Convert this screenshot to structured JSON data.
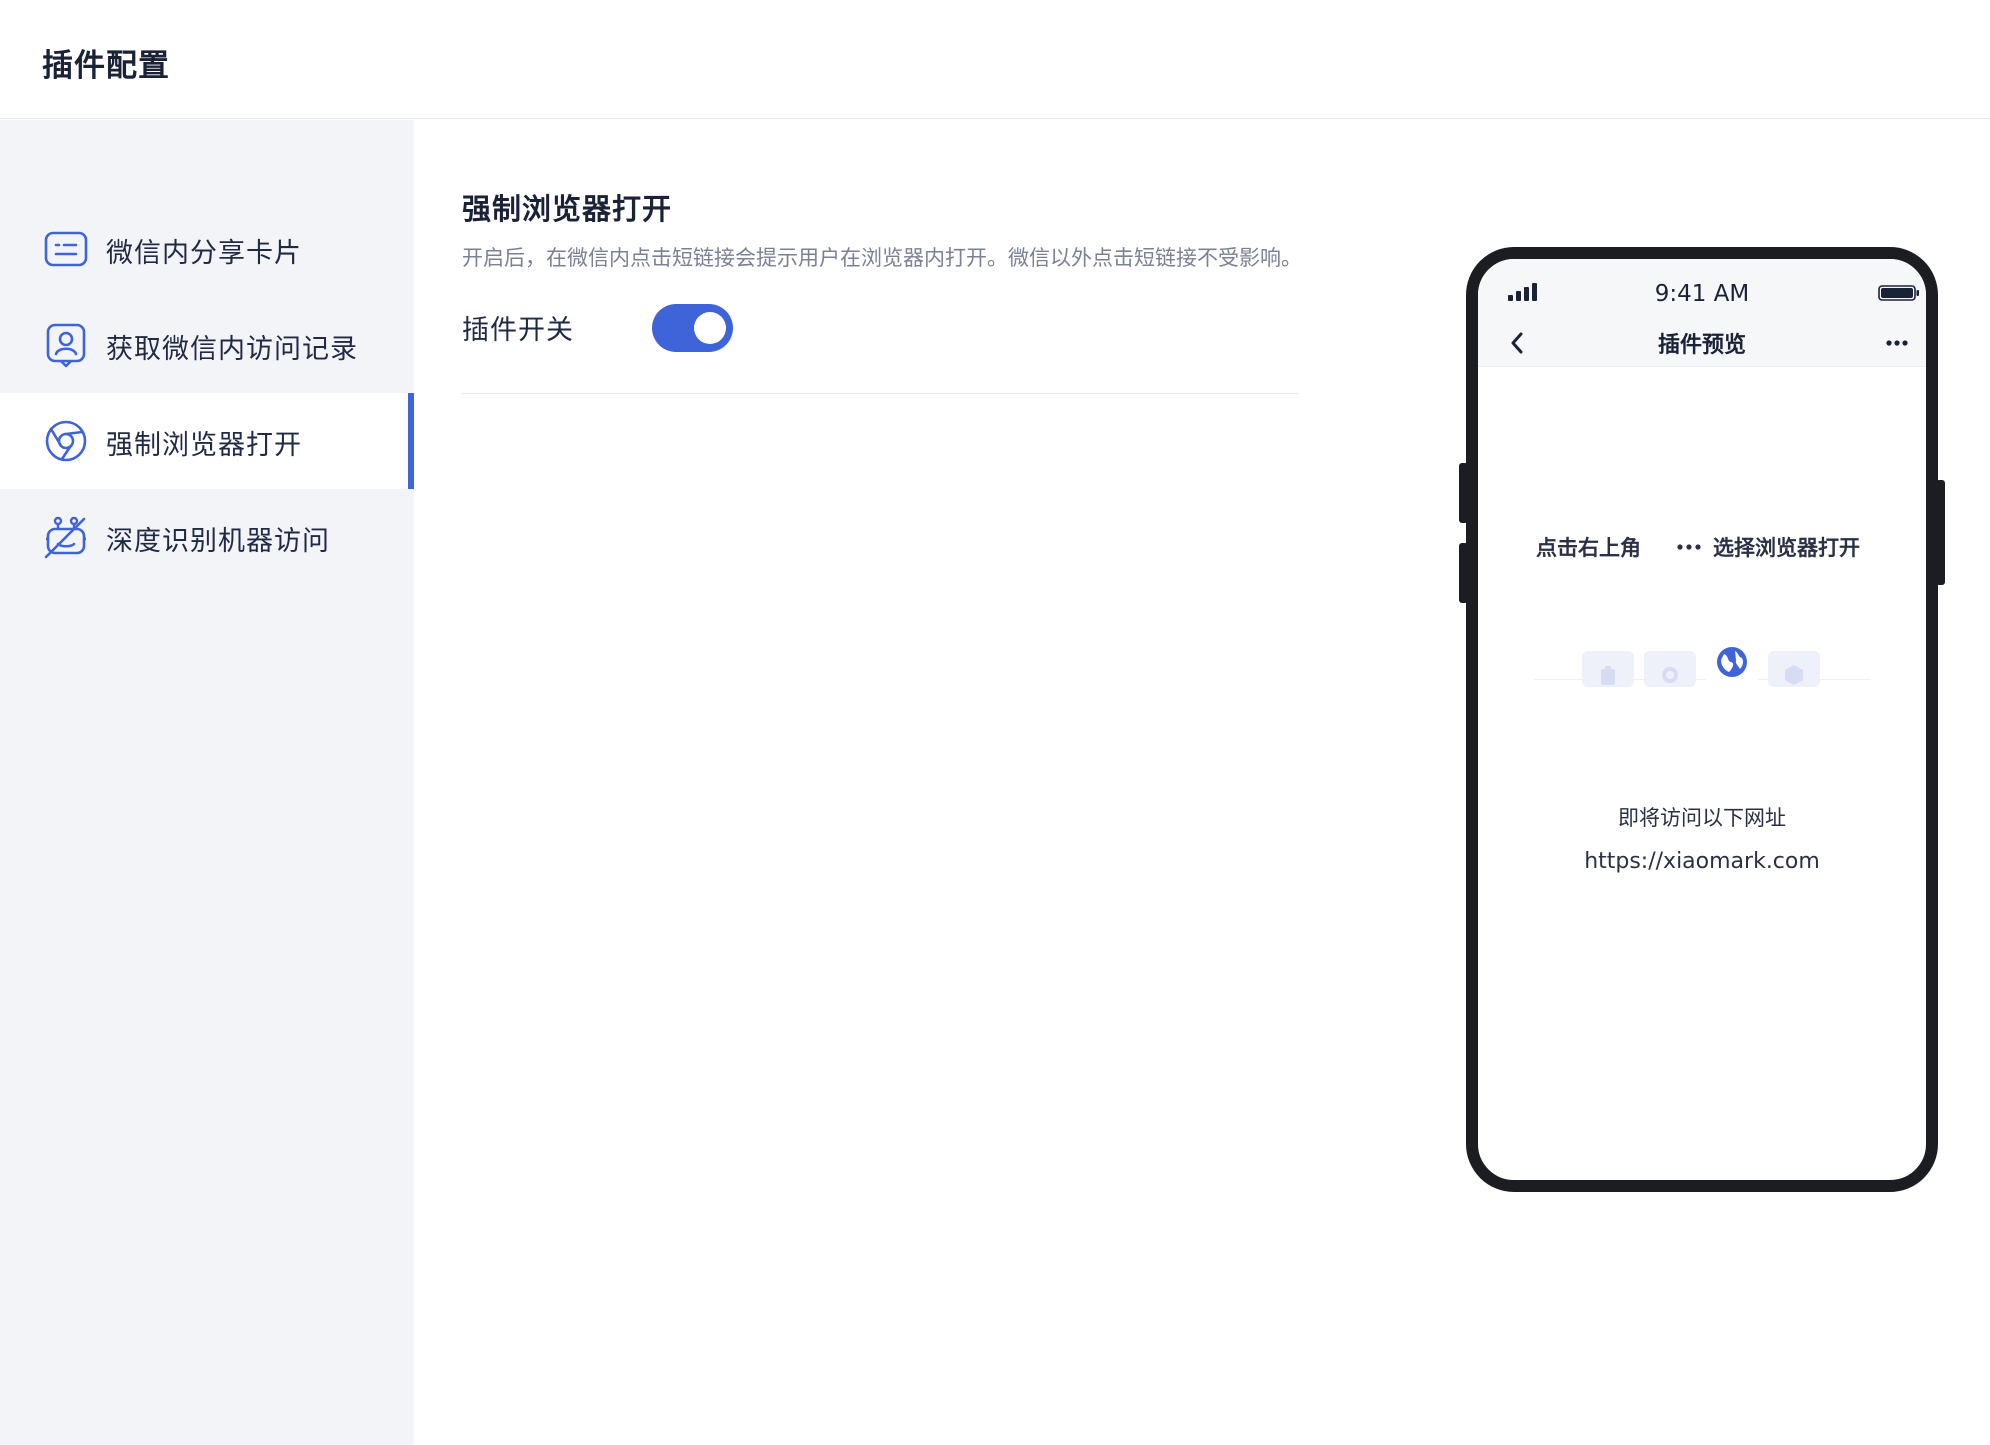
{
  "header": {
    "title": "插件配置"
  },
  "sidebar": {
    "items": [
      {
        "label": "微信内分享卡片",
        "icon": "share-card-icon",
        "active": false
      },
      {
        "label": "获取微信内访问记录",
        "icon": "visitor-record-icon",
        "active": false
      },
      {
        "label": "强制浏览器打开",
        "icon": "browser-icon",
        "active": true
      },
      {
        "label": "深度识别机器访问",
        "icon": "robot-detect-icon",
        "active": false
      }
    ]
  },
  "main": {
    "title": "强制浏览器打开",
    "description": "开启后，在微信内点击短链接会提示用户在浏览器内打开。微信以外点击短链接不受影响。",
    "switch_label": "插件开关",
    "switch_on": true
  },
  "preview": {
    "status_time": "9:41 AM",
    "nav_title": "插件预览",
    "hint_left": "点击右上角",
    "hint_right": "选择浏览器打开",
    "visit_text": "即将访问以下网址",
    "visit_url": "https://xiaomark.com"
  },
  "colors": {
    "accent": "#3f63d8",
    "sidebar_bg": "#f3f4f7",
    "text": "#1f2a44",
    "muted": "#7a8194"
  }
}
